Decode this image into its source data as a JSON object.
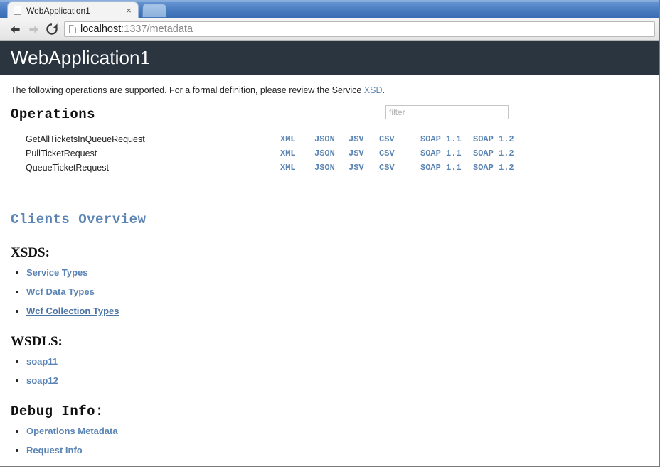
{
  "browser": {
    "tab": {
      "title": "WebApplication1",
      "favicon_icon": "page-icon",
      "close_icon": "close-icon",
      "close_glyph": "×"
    },
    "new_tab_label": "",
    "toolbar": {
      "back_icon": "back-arrow-icon",
      "forward_icon": "forward-arrow-icon",
      "reload_icon": "reload-icon",
      "page_icon": "page-icon",
      "url_host": "localhost",
      "url_path": ":1337/metadata",
      "url_full": "localhost:1337/metadata"
    }
  },
  "page": {
    "header_title": "WebApplication1",
    "header_bg": "#2b3540",
    "link_color": "#5a84b4",
    "intro": {
      "text_before": "The following operations are supported. For a formal definition, please review the Service ",
      "link_label": "XSD",
      "text_after": "."
    },
    "operations_section": {
      "heading": "Operations",
      "filter_placeholder": "filter",
      "filter_value": "",
      "format_columns": [
        "XML",
        "JSON",
        "JSV",
        "CSV",
        "SOAP 1.1",
        "SOAP 1.2"
      ],
      "rows": [
        {
          "name": "GetAllTicketsInQueueRequest",
          "formats": [
            "XML",
            "JSON",
            "JSV",
            "CSV",
            "SOAP 1.1",
            "SOAP 1.2"
          ]
        },
        {
          "name": "PullTicketRequest",
          "formats": [
            "XML",
            "JSON",
            "JSV",
            "CSV",
            "SOAP 1.1",
            "SOAP 1.2"
          ]
        },
        {
          "name": "QueueTicketRequest",
          "formats": [
            "XML",
            "JSON",
            "JSV",
            "CSV",
            "SOAP 1.1",
            "SOAP 1.2"
          ]
        }
      ]
    },
    "clients_overview": {
      "heading": "Clients Overview",
      "xsds": {
        "heading": "XSDS:",
        "links": [
          {
            "label": "Service Types",
            "hovered": false
          },
          {
            "label": "Wcf Data Types",
            "hovered": false
          },
          {
            "label": "Wcf Collection Types",
            "hovered": true
          }
        ]
      },
      "wsdls": {
        "heading": "WSDLS:",
        "links": [
          {
            "label": "soap11",
            "hovered": false
          },
          {
            "label": "soap12",
            "hovered": false
          }
        ]
      },
      "debug_info": {
        "heading": "Debug Info:",
        "links": [
          {
            "label": "Operations Metadata",
            "hovered": false
          },
          {
            "label": "Request Info",
            "hovered": false
          }
        ]
      }
    }
  }
}
